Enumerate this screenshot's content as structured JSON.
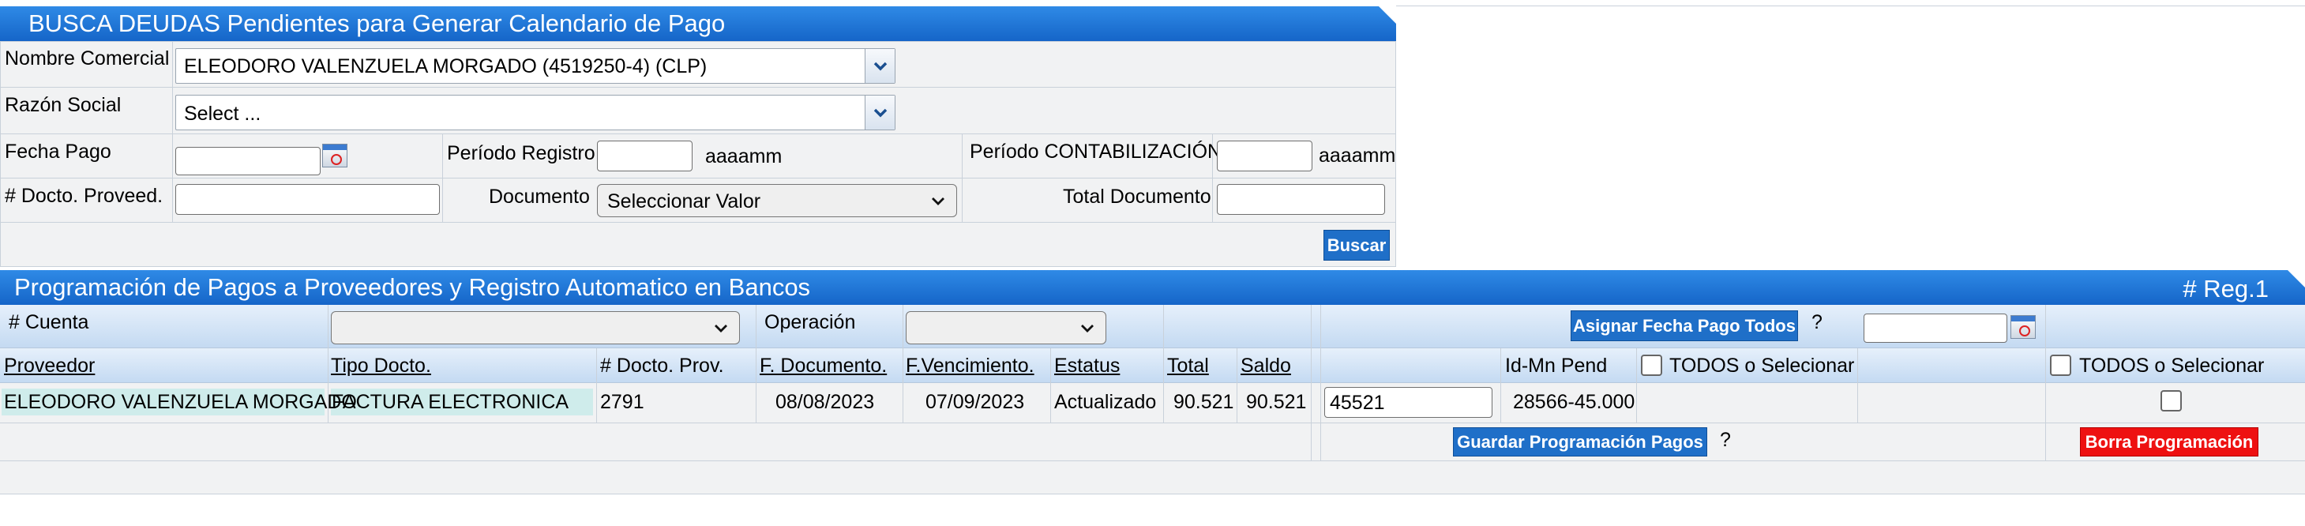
{
  "search_panel": {
    "title": "BUSCA DEUDAS Pendientes para Generar Calendario de Pago",
    "nombre_comercial_label": "Nombre Comercial",
    "nombre_comercial_value": "ELEODORO VALENZUELA MORGADO (4519250-4) (CLP)",
    "razon_social_label": "Razón Social",
    "razon_social_value": "Select ...",
    "fecha_pago_label": "Fecha Pago",
    "periodo_registro_label": "Período Registro",
    "periodo_registro_hint": "aaaamm",
    "periodo_contab_label": "Período CONTABILIZACIÓN",
    "periodo_contab_hint": "aaaamm",
    "docto_proveed_label": "# Docto. Proveed.",
    "documento_label": "Documento",
    "documento_value": "Seleccionar Valor",
    "total_documento_label": "Total Documento",
    "buscar_label": "Buscar"
  },
  "payments_panel": {
    "title": "Programación de Pagos a Proveedores y Registro Automatico en Bancos",
    "reg_count": "# Reg.1",
    "cuenta_label": "# Cuenta",
    "operacion_label": "Operación",
    "asignar_label": "Asignar Fecha Pago Todos",
    "help_mark": "?",
    "columns": {
      "proveedor": "Proveedor",
      "tipo_docto": "Tipo Docto.",
      "docto_prov": "# Docto. Prov.",
      "f_documento": "F. Documento.",
      "f_vencimiento": "F.Vencimiento.",
      "estatus": "Estatus",
      "total": "Total",
      "saldo": "Saldo",
      "id_mn_pend": "Id-Mn Pend",
      "todos_1": "TODOS o Selecionar",
      "todos_2": "TODOS o Selecionar"
    },
    "row": {
      "proveedor": "ELEODORO VALENZUELA MORGADO",
      "tipo_docto": "FACTURA ELECTRONICA",
      "docto_prov": "2791",
      "f_documento": "08/08/2023",
      "f_vencimiento": "07/09/2023",
      "estatus": "Actualizado",
      "total": "90.521",
      "saldo": "90.521",
      "amount_input": "45521",
      "id_mn_pend": "28566-45.000"
    },
    "guardar_label": "Guardar Programación Pagos",
    "borrar_label": "Borra Programación"
  },
  "colors": {
    "header_blue": "#1a6fd0",
    "button_blue": "#1f6fc8",
    "button_red": "#ee1111",
    "row_highlight": "#cfeceb"
  }
}
